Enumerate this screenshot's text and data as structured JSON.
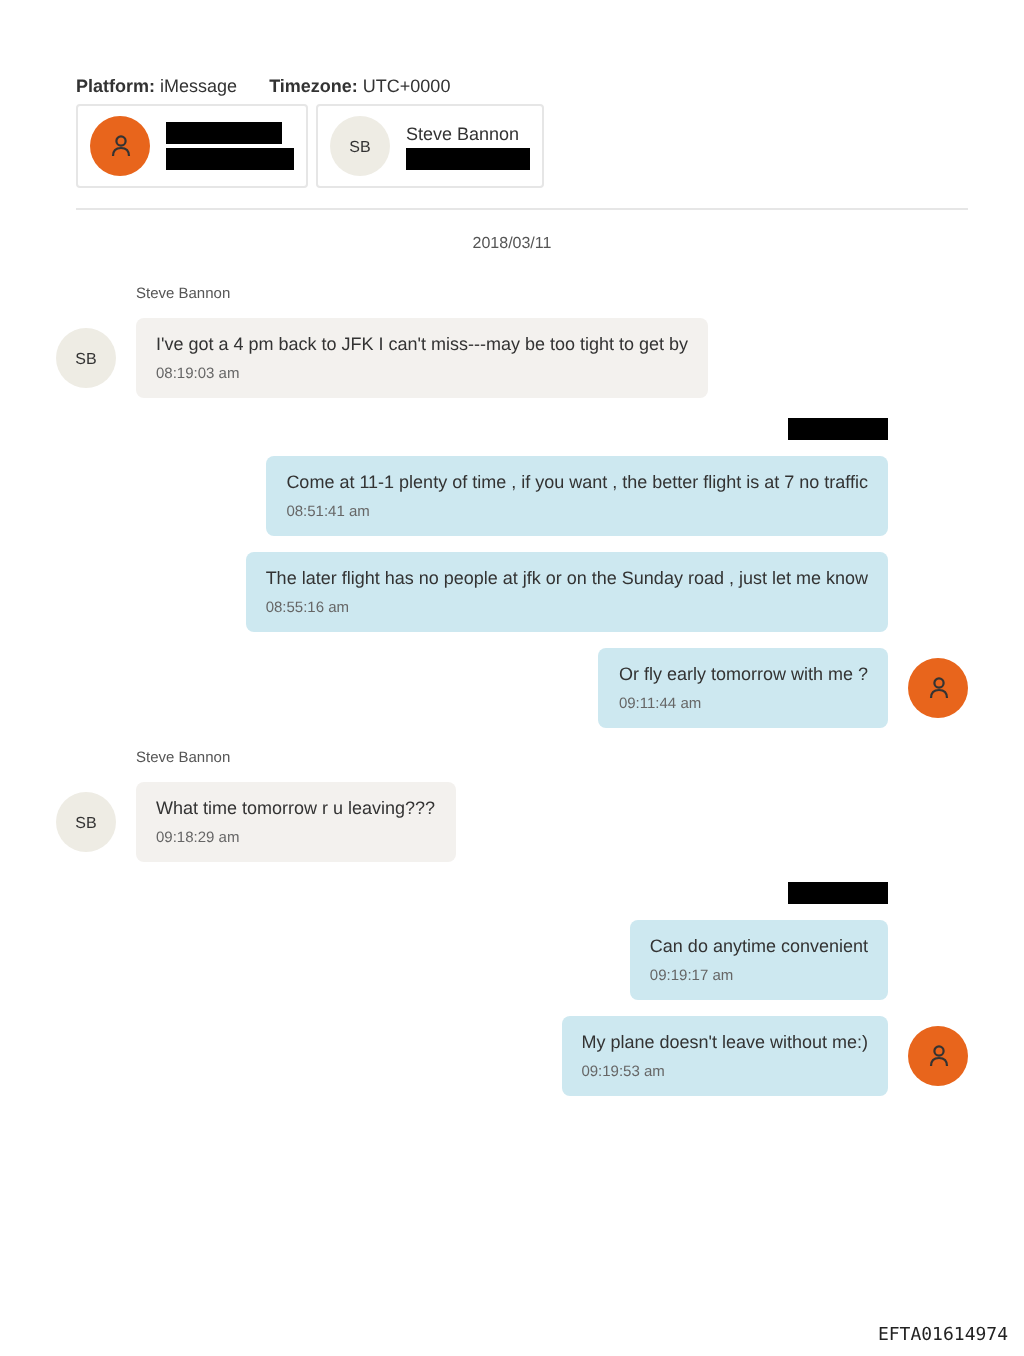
{
  "header": {
    "platform_label": "Platform:",
    "platform": "iMessage",
    "timezone_label": "Timezone:",
    "timezone": "UTC+0000"
  },
  "participants": [
    {
      "avatar": {
        "kind": "icon"
      },
      "name_redacted": true,
      "handle_redacted": true
    },
    {
      "avatar": {
        "kind": "initials",
        "text": "SB"
      },
      "name": "Steve Bannon",
      "handle_redacted": true
    }
  ],
  "date": "2018/03/11",
  "groups": [
    {
      "outgoing": false,
      "sender": "Steve Bannon",
      "avatar": {
        "kind": "initials",
        "text": "SB"
      },
      "messages": [
        {
          "text": "I've got a 4 pm back to JFK I can't miss---may be too tight to get by",
          "time": "08:19:03 am"
        }
      ]
    },
    {
      "outgoing": true,
      "sender_redacted": true,
      "avatar": {
        "kind": "icon"
      },
      "messages": [
        {
          "text": "Come at 11-1 plenty of time , if you want , the better flight is at 7 no traffic",
          "time": "08:51:41 am"
        },
        {
          "text": "The later flight has no people at jfk or on the Sunday road , just let me know",
          "time": "08:55:16 am"
        },
        {
          "text": "Or fly early tomorrow with me ?",
          "time": "09:11:44 am"
        }
      ]
    },
    {
      "outgoing": false,
      "sender": "Steve Bannon",
      "avatar": {
        "kind": "initials",
        "text": "SB"
      },
      "messages": [
        {
          "text": "What time tomorrow r u leaving???",
          "time": "09:18:29 am"
        }
      ]
    },
    {
      "outgoing": true,
      "sender_redacted": true,
      "avatar": {
        "kind": "icon"
      },
      "messages": [
        {
          "text": "Can do anytime convenient",
          "time": "09:19:17 am"
        },
        {
          "text": "My plane doesn't leave without me:)",
          "time": "09:19:53 am"
        }
      ]
    }
  ],
  "footer": "EFTA01614974"
}
